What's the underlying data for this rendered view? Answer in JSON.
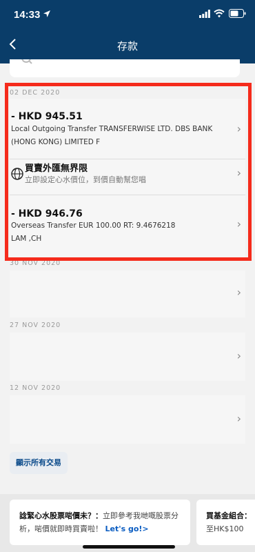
{
  "status_bar": {
    "time": "14:33"
  },
  "header": {
    "title": "存款"
  },
  "groups": [
    {
      "date": "02 DEC 2020",
      "transactions": [
        {
          "amount": "- HKD 945.51",
          "desc_line1": "Local Outgoing Transfer TRANSFERWISE LTD. DBS BANK",
          "desc_line2": "(HONG KONG) LIMITED F"
        },
        {
          "amount": "- HKD 946.76",
          "desc_line1": "Overseas Transfer EUR 100.00 RT: 9.4676218",
          "desc_line2": "LAM ,CH"
        }
      ],
      "promo": {
        "title": "買賣外匯無界限",
        "subtitle": "立即設定心水價位，到價自動幫您唱"
      }
    },
    {
      "date": "30 NOV 2020"
    },
    {
      "date": "27 NOV 2020"
    },
    {
      "date": "12 NOV 2020"
    }
  ],
  "show_all_label": "顯示所有交易",
  "promos": [
    {
      "bold": "諗緊心水股票啱價未？：",
      "text": "立即參考我哋嘅股票分析，啱價就即時買賣啦！",
      "link": "Let's go!>"
    },
    {
      "bold": "買基金組合：",
      "text": "至HK$100"
    }
  ],
  "colors": {
    "header_bg": "#0a3d69",
    "highlight": "#f52b1c",
    "link": "#0a5cc1"
  }
}
